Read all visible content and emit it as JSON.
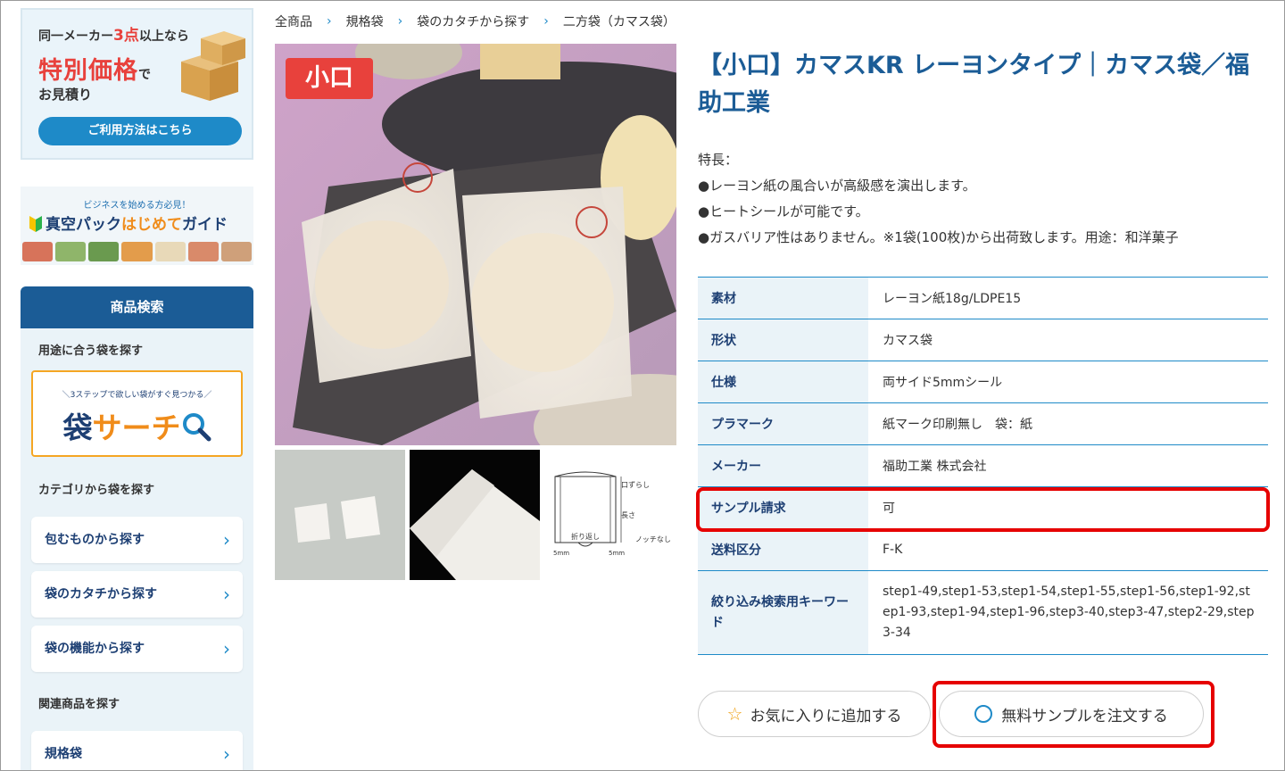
{
  "sidebar": {
    "promo": {
      "line1_prefix": "同一メーカー",
      "line1_num": "3点",
      "line1_suffix": "以上なら",
      "headline": "特別価格",
      "headline_suffix": "で",
      "line3": "お見積り",
      "button": "ご利用方法はこちら"
    },
    "guide": {
      "small": "ビジネスを始める方必見！",
      "big_a": "真空パック",
      "big_b": "はじめて",
      "big_c": "ガイド"
    },
    "search": {
      "header": "商品検索",
      "by_use": "用途に合う袋を探す",
      "fukuro_sub": "＼3ステップで欲しい袋がすぐ見つかる／",
      "fukuro_a": "袋",
      "fukuro_b": "サーチ",
      "by_category": "カテゴリから袋を探す",
      "items": [
        {
          "label": "包むものから探す"
        },
        {
          "label": "袋のカタチから探す"
        },
        {
          "label": "袋の機能から探す"
        }
      ],
      "related": "関連商品を探す",
      "related_item": "規格袋"
    }
  },
  "breadcrumb": [
    "全商品",
    "規格袋",
    "袋のカタチから探す",
    "二方袋（カマス袋）"
  ],
  "product": {
    "badge": "小口",
    "title": "【小口】カマスKR レーヨンタイプ｜カマス袋／福助工業",
    "features_label": "特長：",
    "features": [
      "●レーヨン紙の風合いが高級感を演出します。",
      "●ヒートシールが可能です。",
      "●ガスバリア性はありません。※1袋(100枚)から出荷致します。用途：和洋菓子"
    ],
    "diagram": {
      "label_top": "口ずらし",
      "label_len": "長さ",
      "label_fold": "折り返し",
      "label_notch": "ノッチなし",
      "label_5mm": "5mm"
    },
    "specs": [
      {
        "key": "素材",
        "value": "レーヨン紙18g/LDPE15"
      },
      {
        "key": "形状",
        "value": "カマス袋"
      },
      {
        "key": "仕様",
        "value": "両サイド5mmシール"
      },
      {
        "key": "プラマーク",
        "value": "紙マーク印刷無し　袋：紙"
      },
      {
        "key": "メーカー",
        "value": "福助工業 株式会社"
      },
      {
        "key": "サンプル請求",
        "value": "可"
      },
      {
        "key": "送料区分",
        "value": "F-K"
      },
      {
        "key": "絞り込み検索用キーワード",
        "value": "step1-49,step1-53,step1-54,step1-55,step1-56,step1-92,step1-93,step1-94,step1-96,step3-40,step3-47,step2-29,step3-34"
      }
    ],
    "favorite_button": "お気に入りに追加する",
    "sample_button": "無料サンプルを注文する"
  },
  "colors": {
    "brand_blue": "#1b5c96",
    "accent_blue": "#1e8ac8",
    "highlight_red": "#e60000"
  }
}
